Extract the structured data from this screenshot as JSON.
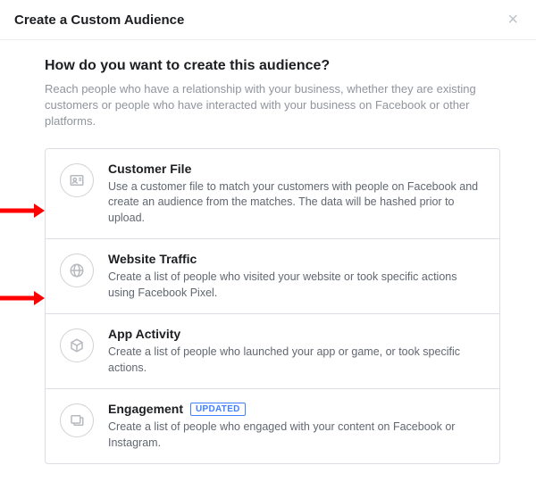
{
  "header": {
    "title": "Create a Custom Audience"
  },
  "body": {
    "question": "How do you want to create this audience?",
    "subtext": "Reach people who have a relationship with your business, whether they are existing customers or people who have interacted with your business on Facebook or other platforms."
  },
  "options": [
    {
      "title": "Customer File",
      "desc": "Use a customer file to match your customers with people on Facebook and create an audience from the matches. The data will be hashed prior to upload."
    },
    {
      "title": "Website Traffic",
      "desc": "Create a list of people who visited your website or took specific actions using Facebook Pixel."
    },
    {
      "title": "App Activity",
      "desc": "Create a list of people who launched your app or game, or took specific actions."
    },
    {
      "title": "Engagement",
      "badge": "UPDATED",
      "desc": "Create a list of people who engaged with your content on Facebook or Instagram."
    }
  ]
}
